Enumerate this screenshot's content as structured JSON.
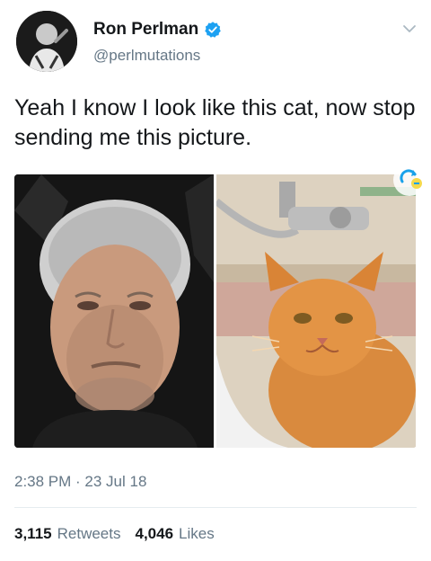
{
  "author": {
    "name": "Ron Perlman",
    "handle": "@perlmutations",
    "verified_color": "#1da1f2"
  },
  "tweet": {
    "text": "Yeah I know I look like this cat, now stop sending me this picture.",
    "timestamp": "2:38 PM · 23 Jul 18"
  },
  "stats": {
    "retweets_count": "3,115",
    "retweets_label": "Retweets",
    "likes_count": "4,046",
    "likes_label": "Likes"
  },
  "icons": {
    "verified": "verified-badge-icon",
    "more": "chevron-down-icon",
    "overlay": "retweet-badge-icon"
  },
  "colors": {
    "text": "#14171a",
    "secondary": "#657786",
    "divider": "#e6ecf0",
    "accent": "#1da1f2"
  }
}
